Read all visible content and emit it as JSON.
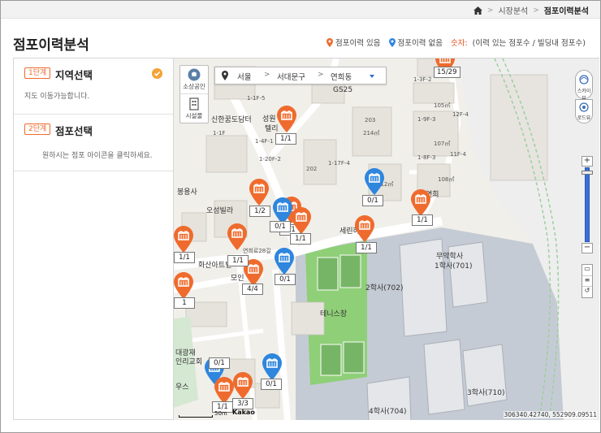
{
  "breadcrumb": {
    "home_icon": "home-icon",
    "items": [
      "시장분석",
      "점포이력분석"
    ]
  },
  "page_title": "점포이력분석",
  "legend": {
    "has_history": "점포이력 있음",
    "no_history": "점포이력 없음",
    "number_key": "숫자:",
    "number_desc": "(이력 있는 점포수 / 빌딩내 점포수)",
    "colors": {
      "has_history": "#ef6b2d",
      "no_history": "#2e86de"
    }
  },
  "steps": [
    {
      "badge": "1단계",
      "title": "지역선택",
      "desc": "지도 이동가능합니다.",
      "completed": true
    },
    {
      "badge": "2단계",
      "title": "점포선택",
      "desc": "원하시는 점포 아이콘을 클릭하세요."
    }
  ],
  "map": {
    "tools": [
      {
        "label": "소상공인",
        "icon": "shop-icon"
      },
      {
        "label": "시설물",
        "icon": "building-icon"
      }
    ],
    "region": {
      "sido": "서울",
      "sigungu": "서대문구",
      "dong": "연희동"
    },
    "right_controls": {
      "skyview": "스카이뷰",
      "roadview": "로드뷰"
    },
    "coordinates": "306340.42740, 552909.09511",
    "scale_text": "50m",
    "provider": "Kakao",
    "place_labels": [
      "GS25",
      "신한꿈도담터",
      "성원",
      "텔리",
      "봉용사",
      "오성빌라",
      "화산아트빌",
      "모인",
      "연희",
      "세린하",
      "무악학사",
      "1학사(701)",
      "2학사(702)",
      "3학사(710)",
      "4학사(704)",
      "테니스장",
      "대광재",
      "인리교회",
      "우스",
      "연희로28길",
      "1-17F-4",
      "1-1F-5",
      "1-3F-2",
      "1-9F-3",
      "12F-4",
      "1-8F-3",
      "11F-4",
      "1-20F-2",
      "1-4F-1",
      "1-1F",
      "202",
      "203",
      "105㎡",
      "107㎡",
      "108㎡",
      "214㎡",
      "212㎡"
    ],
    "markers": [
      {
        "type": "has_history",
        "count": "15/29"
      },
      {
        "type": "has_history",
        "count": "1/1"
      },
      {
        "type": "has_history",
        "count": "1/2"
      },
      {
        "type": "no_history",
        "count": "0/1"
      },
      {
        "type": "has_history",
        "count": "1/1"
      },
      {
        "type": "no_history",
        "count": "0/1"
      },
      {
        "type": "has_history",
        "count": "1/1"
      },
      {
        "type": "has_history",
        "count": "1/1"
      },
      {
        "type": "has_history",
        "count": "1/1"
      },
      {
        "type": "has_history",
        "count": "1/1"
      },
      {
        "type": "no_history",
        "count": "0/1"
      },
      {
        "type": "has_history",
        "count": "4/4"
      },
      {
        "type": "has_history",
        "count": "1/1"
      },
      {
        "type": "has_history",
        "count": "1"
      },
      {
        "type": "no_history",
        "count": "0/1"
      },
      {
        "type": "no_history",
        "count": "0/1"
      },
      {
        "type": "has_history",
        "count": "1/1"
      },
      {
        "type": "has_history",
        "count": "3/3"
      }
    ]
  }
}
